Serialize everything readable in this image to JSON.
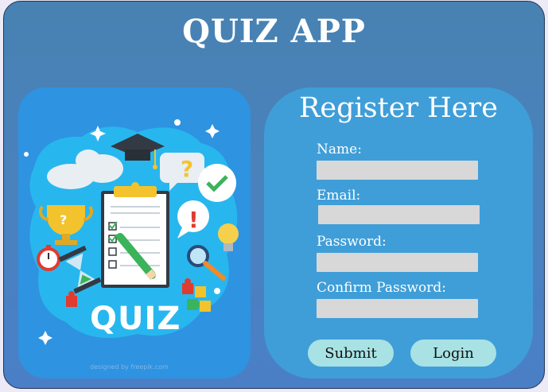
{
  "app": {
    "title": "QUIZ APP"
  },
  "illustration": {
    "word": "QUIZ",
    "credit": "designed by freepik.com",
    "marks": {
      "question": "?",
      "exclaim": "!"
    }
  },
  "register": {
    "title": "Register Here",
    "fields": [
      {
        "label": "Name:",
        "value": "",
        "placeholder": ""
      },
      {
        "label": "Email:",
        "value": "",
        "placeholder": ""
      },
      {
        "label": "Password:",
        "value": "",
        "placeholder": ""
      },
      {
        "label": "Confirm Password:",
        "value": "",
        "placeholder": ""
      }
    ],
    "submit_label": "Submit",
    "login_label": "Login"
  },
  "colors": {
    "window_bg": "#4882b2",
    "panel_bg": "#3f9ed8",
    "input_bg": "#d8d8d8",
    "button_bg": "#a8e2e4",
    "illustration_bg": "#2e93e1"
  },
  "icons": [
    "graduation-cap-icon",
    "clipboard-icon",
    "trophy-icon",
    "stopwatch-icon",
    "hourglass-icon",
    "lightbulb-icon",
    "magnifier-icon",
    "puzzle-icon",
    "cloud-icon",
    "checkmark-bubble-icon",
    "question-bubble-icon",
    "exclamation-bubble-icon"
  ]
}
